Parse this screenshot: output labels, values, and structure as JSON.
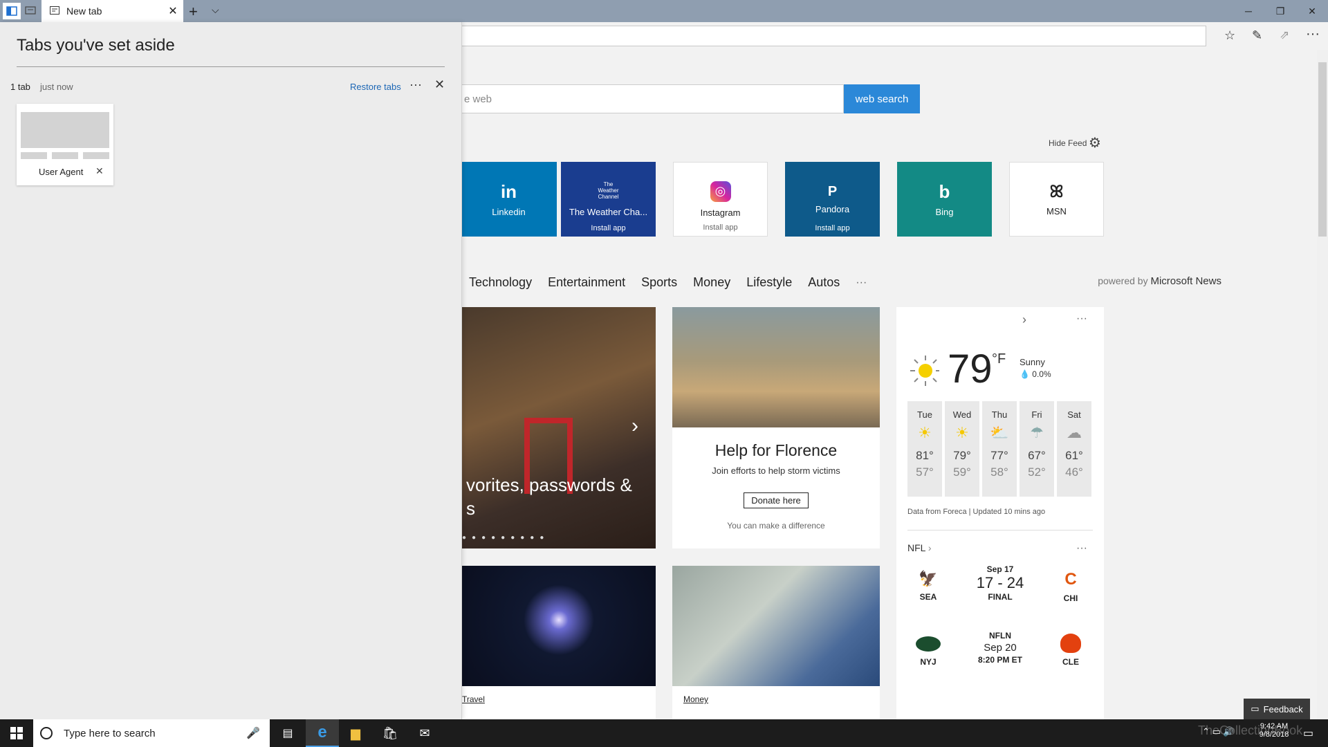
{
  "browser": {
    "tab_title": "New tab",
    "icons": {
      "set_aside": "tabs-aside-icon",
      "restore": "tabs-preview-icon",
      "new_tab": "plus-icon",
      "tab_list": "chevron-down-icon",
      "minimize": "minimize-icon",
      "maximize": "restore-icon",
      "close": "close-icon",
      "favorites": "star-icon",
      "notes": "pen-icon",
      "share": "share-icon",
      "more": "more-icon"
    }
  },
  "aside_panel": {
    "title": "Tabs you've set aside",
    "group_count": "1 tab",
    "group_time": "just now",
    "restore_label": "Restore tabs",
    "more_label": "···",
    "thumb_title": "User Agent"
  },
  "search": {
    "placeholder_visible": "e web",
    "button_label": "web search"
  },
  "feed": {
    "hide_label": "Hide Feed"
  },
  "tiles": [
    {
      "label": "Linkedin",
      "glyph": "in",
      "install": "",
      "color": "#0077b5"
    },
    {
      "label": "The Weather Cha...",
      "glyph": "The Weather Channel",
      "install": "Install app",
      "color": "#1a3d8f"
    },
    {
      "label": "Instagram",
      "glyph": "◎",
      "install": "Install app",
      "color": "#ffffff"
    },
    {
      "label": "Pandora",
      "glyph": "P",
      "install": "Install app",
      "color": "#0e5a8a"
    },
    {
      "label": "Bing",
      "glyph": "b",
      "install": "",
      "color": "#138a85"
    },
    {
      "label": "MSN",
      "glyph": "ꕤ",
      "install": "",
      "color": "#ffffff"
    }
  ],
  "categories": [
    "Technology",
    "Entertainment",
    "Sports",
    "Money",
    "Lifestyle",
    "Autos",
    "···"
  ],
  "powered_by": {
    "prefix": "powered by",
    "brand": "Microsoft News"
  },
  "hero": {
    "caption_line1": "vorites, passwords &",
    "caption_line2": "s"
  },
  "florence": {
    "title": "Help for Florence",
    "subtitle": "Join efforts to help storm victims",
    "button": "Donate here",
    "footer": "You can make a difference"
  },
  "news_tags": {
    "left": "Travel",
    "right": "Money"
  },
  "weather": {
    "temp": "79",
    "unit": "°F",
    "condition": "Sunny",
    "precip": "0.0%",
    "days": [
      {
        "d": "Tue",
        "icon": "sun-icon",
        "hi": "81°",
        "lo": "57°"
      },
      {
        "d": "Wed",
        "icon": "sun-icon",
        "hi": "79°",
        "lo": "59°"
      },
      {
        "d": "Thu",
        "icon": "partly-cloudy-icon",
        "hi": "77°",
        "lo": "58°"
      },
      {
        "d": "Fri",
        "icon": "rain-icon",
        "hi": "67°",
        "lo": "52°"
      },
      {
        "d": "Sat",
        "icon": "cloud-icon",
        "hi": "61°",
        "lo": "46°"
      }
    ],
    "source": "Data from Foreca | Updated 10 mins ago"
  },
  "nfl": {
    "header": "NFL",
    "game1": {
      "home": "SEA",
      "away": "CHI",
      "date": "Sep 17",
      "score": "17 - 24",
      "status": "FINAL"
    },
    "game2": {
      "home": "NYJ",
      "away": "CLE",
      "net": "NFLN",
      "date": "Sep 20",
      "time": "8:20 PM ET"
    }
  },
  "feedback": "Feedback",
  "taskbar": {
    "search_placeholder": "Type here to search",
    "time": "9:42 AM",
    "date": "9/8/2018",
    "watermark": "TheCollectionBook"
  }
}
